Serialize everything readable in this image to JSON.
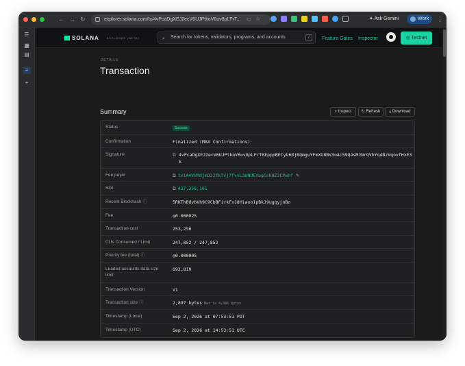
{
  "browser": {
    "url": "explorer.solana.com/tx/4vPcaDgXEJ2ecV6UJPtkoV6uv8pLFrT...",
    "ask_gemini": "Ask Gemini",
    "profile": "Work"
  },
  "header": {
    "logo_text": "SOLANA",
    "logo_subtext": "EXPLORER (BETA)",
    "search_placeholder": "Search for tokens, validators, programs, and accounts",
    "search_shortcut": "/",
    "nav": [
      "Feature Gates",
      "Inspector"
    ],
    "network_button": "Testnet"
  },
  "page": {
    "eyebrow": "DETAILS",
    "title": "Transaction",
    "summary_title": "Summary",
    "buttons": {
      "inspect": "Inspect",
      "refresh": "Refresh",
      "download": "Download"
    }
  },
  "summary": {
    "status_label": "Status",
    "status_value": "Success",
    "confirmation_label": "Confirmation",
    "confirmation_value": "Finalized (MAX Confirmations)",
    "signature_label": "Signature",
    "signature_value": "4vPcaDgXEJ2ecV6UJPtkoV6uv8pLFrT6EpppREtyU68jBQmguYFmXU8BV3uAc59Q4sMJNrQVbYq4BzVqovfHxE3k",
    "fee_payer_label": "Fee payer",
    "fee_payer_value": "tv1A4VVMdjmD3Jfk7vj7fvvL3oNUEYogCokHZ2CPwhf",
    "slot_label": "Slot",
    "slot_value": "437,356,161",
    "blockhash_label": "Recent Blockhash",
    "blockhash_value": "5RKThBdvbVh9C9CbBFirkFx18Hiaoo1pBkJ9ugqyjnBo",
    "fee_label": "Fee",
    "fee_value": "◎0.000025",
    "tx_cost_label": "Transaction cost",
    "tx_cost_value": "253,256",
    "cus_label": "CUs Consumed / Limit",
    "cus_value": "247,852 / 247,852",
    "priority_fee_label": "Priority fee (total)",
    "priority_fee_value": "◎0.000005",
    "loaded_size_label": "Loaded accounts data size limit",
    "loaded_size_value": "692,819",
    "version_label": "Transaction Version",
    "version_value": "V1",
    "tx_size_label": "Transaction size",
    "tx_size_value": "2,897 bytes",
    "tx_size_note": "Max is 4,096 bytes",
    "ts_local_label": "Timestamp (Local)",
    "ts_local_value": "Sep 2, 2026 at 07:53:51 PDT",
    "ts_utc_label": "Timestamp (UTC)",
    "ts_utc_value": "Sep 2, 2026 at 14:53:51 UTC"
  },
  "colors": {
    "accent": "#19c3a0",
    "network": "#19d3a2",
    "success_bg": "#0f4d39",
    "success_text": "#2ee6a5"
  }
}
